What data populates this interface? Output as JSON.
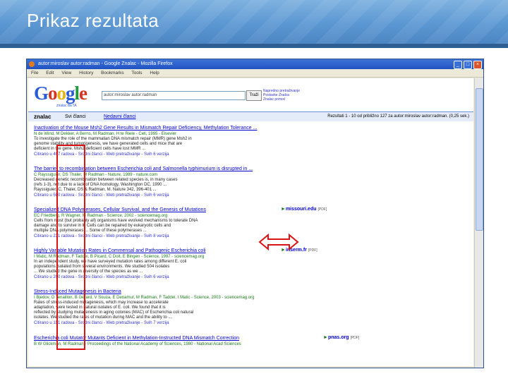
{
  "slide": {
    "title": "Prikaz rezultata"
  },
  "browser": {
    "window_title": "autor:miroslav autor:radman - Google Znalac - Mozilla Firefox",
    "menu": [
      "File",
      "Edit",
      "View",
      "History",
      "Bookmarks",
      "Tools",
      "Help"
    ]
  },
  "search": {
    "query": "autor:miroslav autor:radman",
    "button": "Traži",
    "links": [
      "Napredno pretraživanje",
      "Postavke Znalca",
      "Znalac pomoć"
    ]
  },
  "header": {
    "logo": "Google",
    "logo_sub": "znalac BETA",
    "section": "znalac",
    "tab_all": "Svi članci",
    "tab_recent": "Nedavni članci",
    "stats": "Rezultati 1 - 10 od približno 127 za autor:miroslav autor:radman. (0,25 sek.)"
  },
  "results": [
    {
      "title": "Inactivation of the Mouse Msh2 Gene Results in Mismatch Repair Deficiency, Methylation Tolerance ...",
      "authors": "N de Wind, M Dekker, A Berns, M Radman, H te Riele - Cell, 1995 - Elsevier",
      "snippet": [
        "To investigate the role of the mammalian DNA mismatch repair (MMR) gene Msh2 in",
        "genome stability and tumorigenesis, we have generated cells and mice that are",
        "deficient in the gene. Msh2-deficient cells have lost MMR ..."
      ],
      "links": "Citirano u 407 radova - Srodni članci - Web pretraživanje - Svih 6 verzija",
      "side": "",
      "side_tag": ""
    },
    {
      "title": "The barrier to recombination between Escherichia coli and Salmonella typhimurium is disrupted in ...",
      "authors": "C Rayssiguier, DS Thaler, M Radman - Nature, 1989 - nature.com",
      "snippet": [
        "Decreased genetic recombination between related species is, in many cases",
        "(refs 1-3), not due to a lack of DNA homology, Washington DC, 1990 ...",
        "Rayssiguier, C, Thaler, DS & Radman, M. Nature 342, 396-401 ..."
      ],
      "links": "Citirano u 580 radova - Srodni članci - Web pretraživanje - Svih 6 verzija",
      "side": "",
      "side_tag": ""
    },
    {
      "title": "Specialized DNA Polymerases, Cellular Survival, and the Genesis of Mutations",
      "authors": "EC Friedberg, R Wagner, M Radman - Science, 2002 - sciencemag.org",
      "snippet": [
        "Cells from most (but probably all) organisms have evolved mechanisms to tolerate DNA",
        "damage and to survive in it. Cells can be repaired by eukaryotic cells and",
        "multiple DNA polymerases ... Some of these polymerases ..."
      ],
      "links": "Citirano u 231 radova - Srodni članci - Web pretraživanje - Svih 8 verzija",
      "side": "missouri.edu",
      "side_tag": "[PDF]"
    },
    {
      "title": "Highly Variable Mutation Rates in Commensal and Pathogenic Escherichia coli",
      "authors": "I Matic, M Radman, F Taddei, B Picard, C Doit, E Bingen - Science, 1997 - sciencemag.org",
      "snippet": [
        "In an independent study, we have surveyed mutation rates among different E. coli",
        "populations isolated from several environments. We studied 504 isolates",
        "... We studied the gene in diversity of the species as we ..."
      ],
      "links": "Citirano u 200 radova - Srodni članci - Web pretraživanje - Svih 6 verzija",
      "side": "inserm.fr",
      "side_tag": "[PDF]"
    },
    {
      "title": "Stress-Induced Mutagenesis in Bacteria",
      "authors": "I Bjedov, O Tenaillon, B Gérard, V Souza, E Denamur, M Radman, F Taddei, I Matic - Science, 2003 - sciencemag.org",
      "snippet": [
        "Rates of stress-induced mutagenesis, which may increase to accelerate",
        "adaptation, were tested in natural isolates of E. coli. We found that it is",
        "reflected by studying mutagenesis in aging colonies (MAC) of Escherichia coli natural",
        "isolates. We studied the rates of mutation during MAC and the ability to ..."
      ],
      "links": "Citirano u 151 radova - Srodni članci - Web pretraživanje - Svih 7 verzija",
      "side": "",
      "side_tag": ""
    },
    {
      "title": "Escherichia coli Mutator Mutants Deficient in Methylation-Instructed DNA Mismatch Correction",
      "authors": "B W Glickman, M Radman - Proceedings of the National Academy of Sciences, 1980 - National Acad Sciences",
      "snippet": [],
      "links": "",
      "side": "pnas.org",
      "side_tag": "[PDF]"
    }
  ]
}
